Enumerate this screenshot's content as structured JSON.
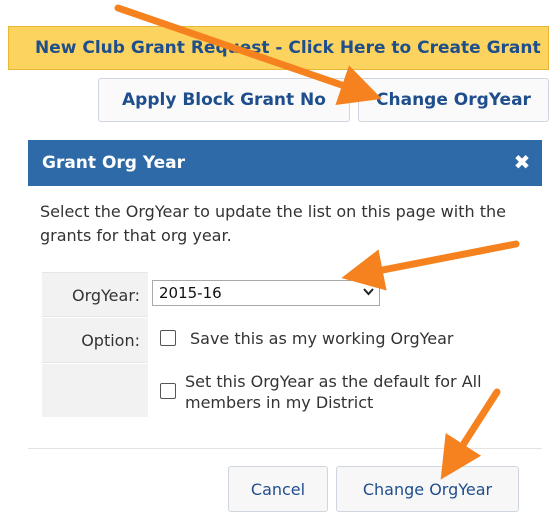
{
  "banner": {
    "text": "New Club Grant Request - Click Here to Create Grant"
  },
  "toolbar": {
    "apply_block_label": "Apply Block Grant No",
    "change_orgyear_label": "Change OrgYear"
  },
  "dialog": {
    "title": "Grant Org Year",
    "close_glyph": "✖",
    "intro": "Select the OrgYear to update the list on this page with the grants for that org year.",
    "orgyear_label": "OrgYear:",
    "orgyear_value": "2015-16",
    "option_label": "Option:",
    "option_working": "Save this as my working OrgYear",
    "option_default": "Set this OrgYear as the default for All members in my District",
    "cancel_label": "Cancel",
    "change_label": "Change OrgYear"
  },
  "colors": {
    "banner_bg": "#fbd35e",
    "titlebar_bg": "#2e6aa8",
    "link_blue": "#1f4e8c",
    "annotation_orange": "#f5821f"
  }
}
